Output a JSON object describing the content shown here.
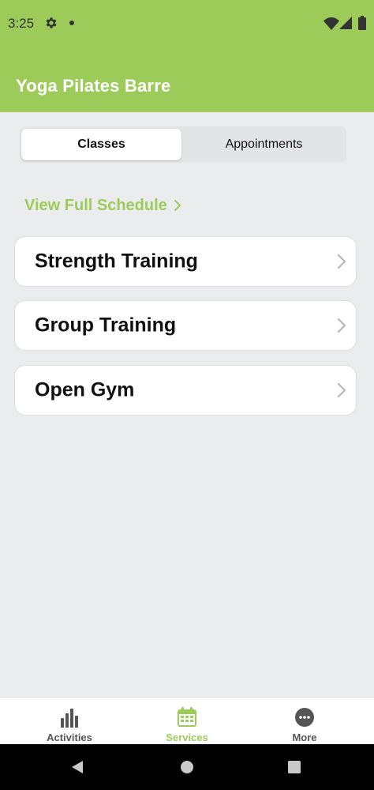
{
  "status_bar": {
    "time": "3:25",
    "icons": [
      "gear-icon",
      "notification-dot-icon",
      "wifi-icon",
      "signal-icon",
      "battery-icon"
    ]
  },
  "header": {
    "title": "Yoga Pilates Barre",
    "background_color": "#9dcb59"
  },
  "segmented": {
    "tabs": [
      {
        "label": "Classes",
        "selected": true
      },
      {
        "label": "Appointments",
        "selected": false
      }
    ]
  },
  "schedule_link": {
    "label": "View Full Schedule",
    "icon": "chevron-right-icon",
    "color": "#9dcb59"
  },
  "categories": [
    {
      "label": "Strength Training",
      "icon": "chevron-right-icon"
    },
    {
      "label": "Group Training",
      "icon": "chevron-right-icon"
    },
    {
      "label": "Open Gym",
      "icon": "chevron-right-icon"
    }
  ],
  "tab_bar": {
    "items": [
      {
        "label": "Activities",
        "icon": "bar-chart-icon",
        "active": false
      },
      {
        "label": "Services",
        "icon": "calendar-icon",
        "active": true
      },
      {
        "label": "More",
        "icon": "more-dots-icon",
        "active": false
      }
    ],
    "active_color": "#9dcb59"
  },
  "system_nav": {
    "buttons": [
      "back-icon",
      "home-icon",
      "recents-icon"
    ]
  }
}
